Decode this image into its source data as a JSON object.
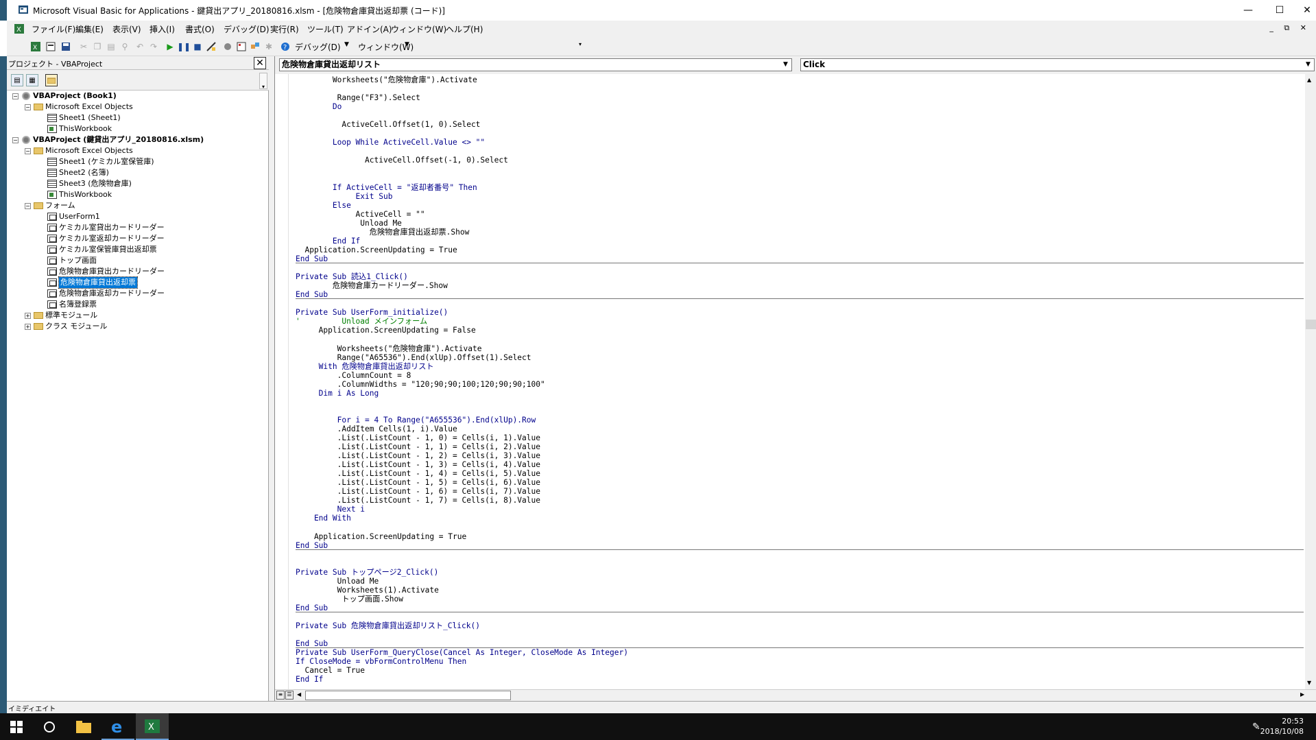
{
  "window": {
    "title": "Microsoft Visual Basic for Applications - 鍵貸出アプリ_20180816.xlsm - [危険物倉庫貸出返却票 (コード)]",
    "minimize": "—",
    "maximize": "☐",
    "close": "✕"
  },
  "menubar": {
    "items": [
      "ファイル(F)",
      "編集(E)",
      "表示(V)",
      "挿入(I)",
      "書式(O)",
      "デバッグ(D)",
      "実行(R)",
      "ツール(T)",
      "アドイン(A)",
      "ウィンドウ(W)",
      "ヘルプ(H)"
    ],
    "mdi_controls": "_ ⧉ ✕"
  },
  "toolbar": {
    "debug_label": "デバッグ(D)",
    "window_label": "ウィンドウ(W)"
  },
  "project_panel": {
    "title": "プロジェクト - VBAProject",
    "close": "✕",
    "tree": [
      {
        "label": "VBAProject (Book1)",
        "level": 0,
        "icon": "project-icon",
        "expander": "−",
        "bold": true
      },
      {
        "label": "Microsoft Excel Objects",
        "level": 1,
        "icon": "folder-icon",
        "expander": "−"
      },
      {
        "label": "Sheet1 (Sheet1)",
        "level": 2,
        "icon": "sheet-icon"
      },
      {
        "label": "ThisWorkbook",
        "level": 2,
        "icon": "workbook-icon"
      },
      {
        "label": "VBAProject (鍵貸出アプリ_20180816.xlsm)",
        "level": 0,
        "icon": "project-icon",
        "expander": "−",
        "bold": true
      },
      {
        "label": "Microsoft Excel Objects",
        "level": 1,
        "icon": "folder-icon",
        "expander": "−"
      },
      {
        "label": "Sheet1 (ケミカル室保管庫)",
        "level": 2,
        "icon": "sheet-icon"
      },
      {
        "label": "Sheet2 (名簿)",
        "level": 2,
        "icon": "sheet-icon"
      },
      {
        "label": "Sheet3 (危険物倉庫)",
        "level": 2,
        "icon": "sheet-icon"
      },
      {
        "label": "ThisWorkbook",
        "level": 2,
        "icon": "workbook-icon"
      },
      {
        "label": "フォーム",
        "level": 1,
        "icon": "folder-icon",
        "expander": "−"
      },
      {
        "label": "UserForm1",
        "level": 2,
        "icon": "form-icon"
      },
      {
        "label": "ケミカル室貸出カードリーダー",
        "level": 2,
        "icon": "form-icon"
      },
      {
        "label": "ケミカル室返却カードリーダー",
        "level": 2,
        "icon": "form-icon"
      },
      {
        "label": "ケミカル室保管庫貸出返却票",
        "level": 2,
        "icon": "form-icon"
      },
      {
        "label": "トップ画面",
        "level": 2,
        "icon": "form-icon"
      },
      {
        "label": "危険物倉庫貸出カードリーダー",
        "level": 2,
        "icon": "form-icon"
      },
      {
        "label": "危険物倉庫貸出返却票",
        "level": 2,
        "icon": "form-icon",
        "selected": true
      },
      {
        "label": "危険物倉庫返却カードリーダー",
        "level": 2,
        "icon": "form-icon"
      },
      {
        "label": "名簿登録票",
        "level": 2,
        "icon": "form-icon"
      },
      {
        "label": "標準モジュール",
        "level": 1,
        "icon": "folder-icon",
        "expander": "+"
      },
      {
        "label": "クラス モジュール",
        "level": 1,
        "icon": "folder-icon",
        "expander": "+"
      }
    ]
  },
  "code_window": {
    "object_combo": "危険物倉庫貸出返却リスト",
    "procedure_combo": "Click",
    "lines": [
      {
        "t": "        Worksheets(\"危険物倉庫\").Activate"
      },
      {
        "t": ""
      },
      {
        "t": "         Range(\"F3\").Select"
      },
      {
        "t": "        Do",
        "k": true
      },
      {
        "t": ""
      },
      {
        "t": "          ActiveCell.Offset(1, 0).Select"
      },
      {
        "t": ""
      },
      {
        "t": "        Loop While ActiveCell.Value <> \"\"",
        "k": true
      },
      {
        "t": ""
      },
      {
        "t": "               ActiveCell.Offset(-1, 0).Select"
      },
      {
        "t": ""
      },
      {
        "t": ""
      },
      {
        "t": "        If ActiveCell = \"返却者番号\" Then",
        "k": true
      },
      {
        "t": "             Exit Sub",
        "k": true
      },
      {
        "t": "        Else",
        "k": true
      },
      {
        "t": "             ActiveCell = \"\""
      },
      {
        "t": "              Unload Me"
      },
      {
        "t": "                危険物倉庫貸出返却票.Show"
      },
      {
        "t": "        End If",
        "k": true
      },
      {
        "t": "  Application.ScreenUpdating = True"
      },
      {
        "t": "End Sub",
        "k": true,
        "sep": true
      },
      {
        "t": ""
      },
      {
        "t": "Private Sub 読込1_Click()",
        "k": true
      },
      {
        "t": "        危険物倉庫カードリーダー.Show"
      },
      {
        "t": "End Sub",
        "k": true,
        "sep": true
      },
      {
        "t": ""
      },
      {
        "t": "Private Sub UserForm_initialize()",
        "k": true
      },
      {
        "t": "'         Unload メインフォーム",
        "c": true
      },
      {
        "t": "     Application.ScreenUpdating = False"
      },
      {
        "t": ""
      },
      {
        "t": "         Worksheets(\"危険物倉庫\").Activate"
      },
      {
        "t": "         Range(\"A65536\").End(xlUp).Offset(1).Select"
      },
      {
        "t": "     With 危険物倉庫貸出返却リスト",
        "k": true
      },
      {
        "t": "         .ColumnCount = 8"
      },
      {
        "t": "         .ColumnWidths = \"120;90;90;100;120;90;90;100\""
      },
      {
        "t": "     Dim i As Long",
        "k": true
      },
      {
        "t": ""
      },
      {
        "t": ""
      },
      {
        "t": "         For i = 4 To Range(\"A655536\").End(xlUp).Row",
        "k": true
      },
      {
        "t": "         .AddItem Cells(1, i).Value"
      },
      {
        "t": "         .List(.ListCount - 1, 0) = Cells(i, 1).Value"
      },
      {
        "t": "         .List(.ListCount - 1, 1) = Cells(i, 2).Value"
      },
      {
        "t": "         .List(.ListCount - 1, 2) = Cells(i, 3).Value"
      },
      {
        "t": "         .List(.ListCount - 1, 3) = Cells(i, 4).Value"
      },
      {
        "t": "         .List(.ListCount - 1, 4) = Cells(i, 5).Value"
      },
      {
        "t": "         .List(.ListCount - 1, 5) = Cells(i, 6).Value"
      },
      {
        "t": "         .List(.ListCount - 1, 6) = Cells(i, 7).Value"
      },
      {
        "t": "         .List(.ListCount - 1, 7) = Cells(i, 8).Value"
      },
      {
        "t": "         Next i",
        "k": true
      },
      {
        "t": "    End With",
        "k": true
      },
      {
        "t": ""
      },
      {
        "t": "    Application.ScreenUpdating = True"
      },
      {
        "t": "End Sub",
        "k": true,
        "sep": true
      },
      {
        "t": ""
      },
      {
        "t": ""
      },
      {
        "t": "Private Sub トップページ2_Click()",
        "k": true
      },
      {
        "t": "         Unload Me"
      },
      {
        "t": "         Worksheets(1).Activate"
      },
      {
        "t": "          トップ画面.Show"
      },
      {
        "t": "End Sub",
        "k": true,
        "sep": true
      },
      {
        "t": ""
      },
      {
        "t": "Private Sub 危険物倉庫貸出返却リスト_Click()",
        "k": true
      },
      {
        "t": ""
      },
      {
        "t": "End Sub",
        "k": true,
        "sep": true
      },
      {
        "t": "Private Sub UserForm_QueryClose(Cancel As Integer, CloseMode As Integer)",
        "k": true
      },
      {
        "t": "If CloseMode = vbFormControlMenu Then",
        "k": true
      },
      {
        "t": "  Cancel = True"
      },
      {
        "t": "End If",
        "k": true
      }
    ]
  },
  "immediate": {
    "label": "イミディエイト"
  },
  "taskbar": {
    "time": "20:53",
    "date": "2018/10/08"
  }
}
